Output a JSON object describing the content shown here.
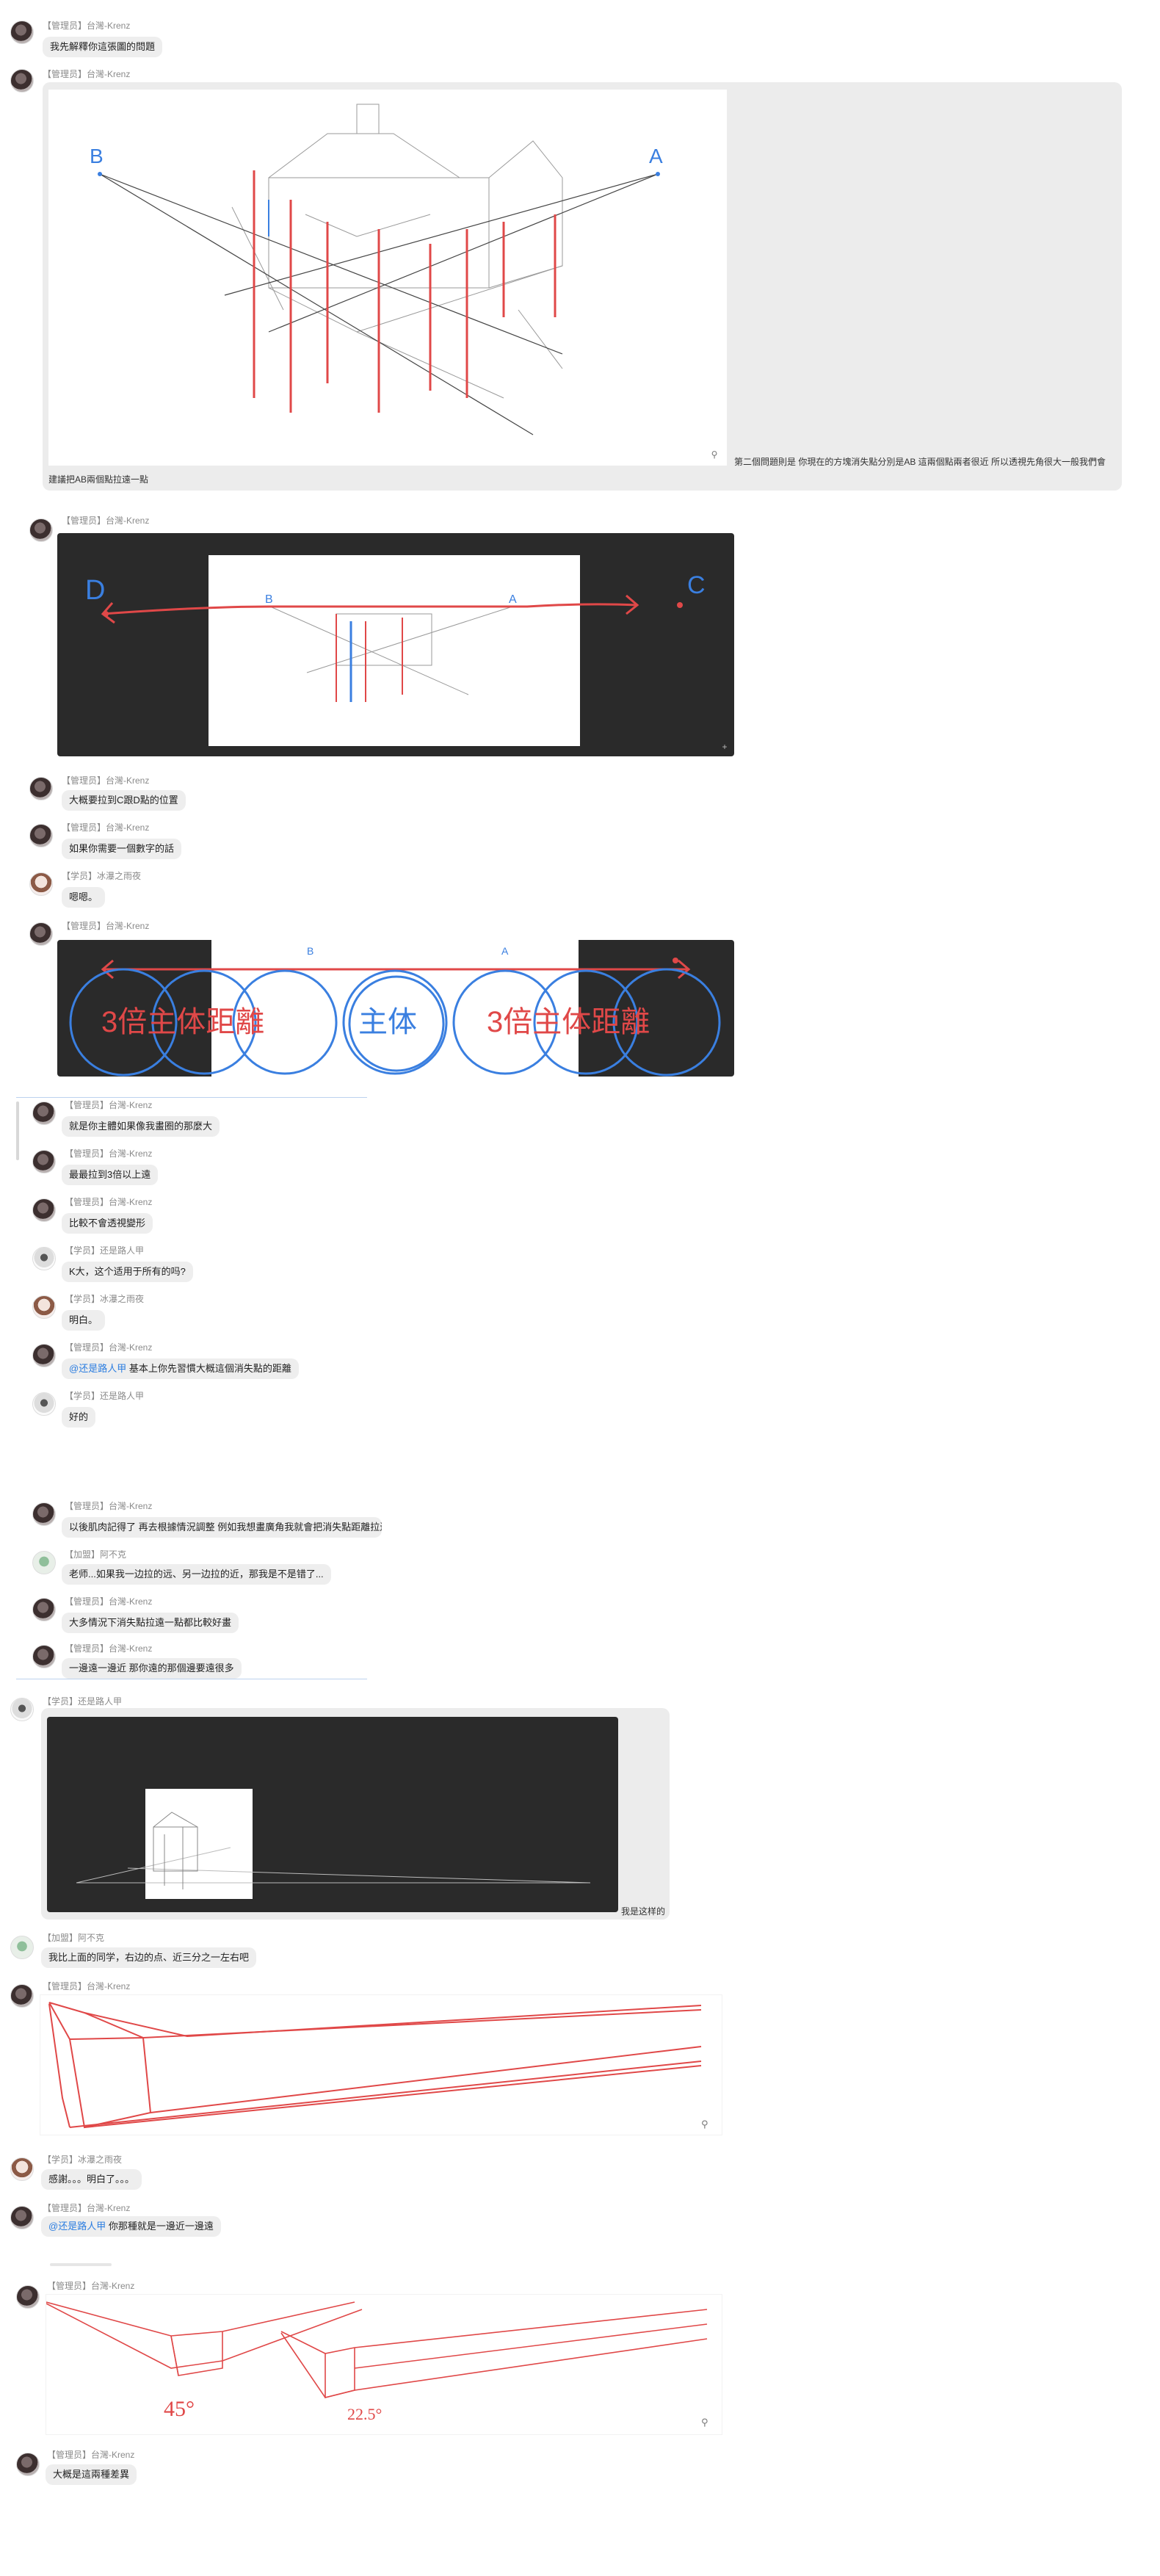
{
  "messages": [
    {
      "sender": "【管理员】台灣-Krenz",
      "text": "我先解釋你這張圖的問題"
    },
    {
      "sender": "【管理员】台灣-Krenz",
      "caption": "建議把AB兩個點拉遠一點",
      "side_text": "第二個問題則是 你現在的方塊消失點分別是AB 這兩個點兩者很近 所以透視先角很大一般我們會",
      "sketch_labels": [
        "B",
        "A"
      ]
    },
    {
      "sender": "【管理员】台灣-Krenz",
      "sketch_labels": [
        "D",
        "B",
        "A",
        "C"
      ]
    },
    {
      "sender": "【管理员】台灣-Krenz",
      "text": "大概要拉到C跟D點的位置"
    },
    {
      "sender": "【管理员】台灣-Krenz",
      "text": "如果你需要一個數字的話"
    },
    {
      "sender": "【学员】冰瀑之雨夜",
      "text": "嗯嗯。"
    },
    {
      "sender": "【管理员】台灣-Krenz",
      "sketch_labels": [
        "B",
        "A",
        "3倍主体距離",
        "主体",
        "3倍主体距離"
      ]
    },
    {
      "sender": "【管理员】台灣-Krenz",
      "text": "就是你主體如果像我畫圈的那麼大"
    },
    {
      "sender": "【管理员】台灣-Krenz",
      "text": "最最拉到3倍以上遠"
    },
    {
      "sender": "【管理员】台灣-Krenz",
      "text": "比較不會透視變形"
    },
    {
      "sender": "【学员】还是路人甲",
      "text": "K大，这个适用于所有的吗?"
    },
    {
      "sender": "【学员】冰瀑之雨夜",
      "text": "明白。"
    },
    {
      "sender": "【管理员】台灣-Krenz",
      "mention": "@还是路人甲",
      "text": "基本上你先習慣大概這個消失點的距離"
    },
    {
      "sender": "【学员】还是路人甲",
      "text": "好的"
    },
    {
      "sender": "【管理员】台灣-Krenz",
      "text": "以後肌肉記得了 再去根據情況調整 例如我想畫廣角我就會把消失點距離拉近"
    },
    {
      "sender": "【加盟】阿不克",
      "text": "老师...如果我一边拉的远、另一边拉的近，那我是不是错了..."
    },
    {
      "sender": "【管理员】台灣-Krenz",
      "text": "大多情況下消失點拉遠一點都比較好畫"
    },
    {
      "sender": "【管理员】台灣-Krenz",
      "text": "一邊遠一邊近  那你遠的那個邊要遠很多"
    },
    {
      "sender": "【学员】还是路人甲",
      "caption": "我是这样的"
    },
    {
      "sender": "【加盟】阿不克",
      "text": "我比上面的同学，右边的点、近三分之一左右吧"
    },
    {
      "sender": "【管理员】台灣-Krenz"
    },
    {
      "sender": "【学员】冰瀑之雨夜",
      "text": "感謝。。。明白了。。。"
    },
    {
      "sender": "【管理员】台灣-Krenz",
      "mention": "@还是路人甲",
      "text": "你那種就是一邊近一邊遠"
    },
    {
      "sender": "【管理员】台灣-Krenz",
      "sketch_labels": [
        "45°",
        "22.5°"
      ]
    },
    {
      "sender": "【管理员】台灣-Krenz",
      "text": "大概是這兩種差異"
    }
  ],
  "icons": {
    "zoom": "magnifier-icon",
    "expand": "expand-icon"
  },
  "colors": {
    "bubble": "#eeeeee",
    "mention": "#2b7de0",
    "sender": "#8a8a8a",
    "sketch_red": "#e04848",
    "sketch_blue": "#3a7fe0",
    "dark_frame": "#2a2a2a"
  }
}
